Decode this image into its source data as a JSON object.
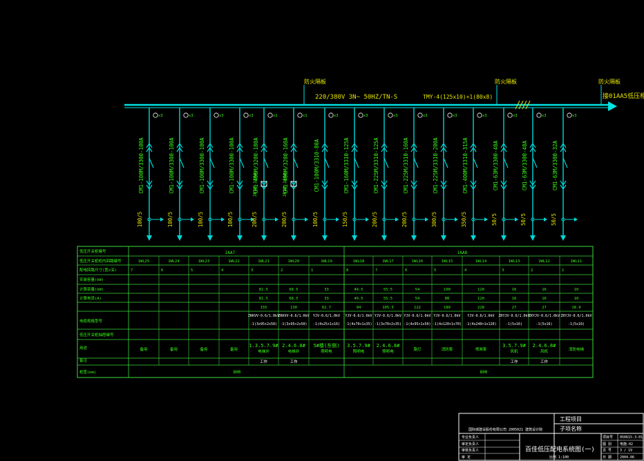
{
  "colors": {
    "background": "#000000",
    "bus": "#00e5e5",
    "feeder": "#00d8d8",
    "label_green": "#39ff14",
    "label_yellow": "#e6e600",
    "table_line": "#3cdc3c",
    "title_block": "#ffffff"
  },
  "top": {
    "marker1": "防火隔板",
    "marker2": "防火隔板",
    "marker3": "防火隔板",
    "bus_spec": "220/380V  3N~ 50HZ/TN-S",
    "busbar_spec": "TMY-4(125x10)+1(80x8)",
    "continuation": "接01AA5低压柜"
  },
  "feeders": [
    {
      "tag": "⑩x3",
      "breaker": "CM1-100M/3300-100A",
      "ct": "100/5",
      "type": "normal"
    },
    {
      "tag": "⑩x3",
      "breaker": "CM1-100M/3300-100A",
      "ct": "100/5",
      "type": "normal"
    },
    {
      "tag": "⑩x3",
      "breaker": "CM1-100M/3300-100A",
      "ct": "100/5",
      "type": "normal"
    },
    {
      "tag": "⑩x3",
      "breaker": "CM1-100M/3300-100A",
      "ct": "100/5",
      "type": "normal"
    },
    {
      "tag": "⑩x1",
      "breaker": "CM1-400M/3200-180A",
      "ct": "200/5",
      "type": "contactor",
      "relay": "JR22-180A"
    },
    {
      "tag": "⑩x1",
      "breaker": "CM1-400M/3200-160A",
      "ct": "200/5",
      "type": "contactor",
      "relay": "JR22-160A"
    },
    {
      "tag": "⑩x3",
      "breaker": "CM1-100M/3310-80A",
      "ct": "100/5",
      "type": "normal"
    },
    {
      "tag": "⑩x3",
      "breaker": "CM1-160M/3310-125A",
      "ct": "150/5",
      "type": "normal"
    },
    {
      "tag": "⑩x3",
      "breaker": "CM1-225M/3310-125A",
      "ct": "200/5",
      "type": "normal"
    },
    {
      "tag": "⑩x3",
      "breaker": "CM1-225M/3310-160A",
      "ct": "200/5",
      "type": "normal"
    },
    {
      "tag": "⑩x3",
      "breaker": "CM1-225M/3310-200A",
      "ct": "300/5",
      "type": "normal"
    },
    {
      "tag": "⑩x3",
      "breaker": "CM1-400M/3310-315A",
      "ct": "350/5",
      "type": "normal"
    },
    {
      "tag": "⑩x3",
      "breaker": "CM1-63M/3300-40A",
      "ct": "50/5",
      "type": "normal"
    },
    {
      "tag": "⑩x3",
      "breaker": "CM1-63M/3300-40A",
      "ct": "50/5",
      "type": "normal"
    },
    {
      "tag": "⑩x3",
      "breaker": "CM1-63M/3300-32A",
      "ct": "50/5",
      "type": "normal"
    }
  ],
  "table": {
    "row_labels": [
      "低压开关柜编号",
      "低压开关柜柜内回路编号",
      "配电回路尺寸(宽x深)",
      "安装容量(kW)",
      "计算容量(kW)",
      "计算电流(A)",
      "电缆规格型号",
      "低压开关柜抽屉编号",
      "用途",
      "备注",
      "柜宽(mm)"
    ],
    "cabinet_a": "1AA7",
    "cabinet_b": "1AA8",
    "circuit_nos": [
      "1WL25",
      "1WL24",
      "1WL23",
      "1WL22",
      "1WL21",
      "1WL20",
      "1WL19",
      "1WL18",
      "1WL17",
      "1WL16",
      "1WL15",
      "1WL14",
      "1WL13",
      "1WL12",
      "1WL11"
    ],
    "drawer_sizes": [
      "7",
      "6",
      "5",
      "4",
      "3",
      "2",
      "1",
      "8",
      "7",
      "6",
      "5",
      "4",
      "3",
      "2",
      "1"
    ],
    "installed_kw": [
      "",
      "",
      "",
      "",
      "81.5",
      "68.5",
      "33",
      "49.5",
      "55.5",
      "54",
      "100",
      "120",
      "16",
      "16",
      "10"
    ],
    "calc_kw": [
      "",
      "",
      "",
      "",
      "81.5",
      "68.5",
      "33",
      "49.5",
      "55.5",
      "54",
      "80",
      "120",
      "16",
      "16",
      "10"
    ],
    "calc_a": [
      "",
      "",
      "",
      "",
      "155",
      "130",
      "62.7",
      "94",
      "105.5",
      "122",
      "189",
      "228",
      "27",
      "27",
      "18.9"
    ],
    "cable_a": [
      "",
      "",
      "",
      "",
      "ZRKVV-0.6/1.0kV",
      "ZRKVV-0.6/1.0kV",
      "YJV-0.6/1.0kV",
      "YJV-0.6/1.0kV",
      "YJV-0.6/1.0kV",
      "YJV-0.6/1.0kV",
      "YJV-0.6/1.0kV",
      "YJV-0.6/1.0kV",
      "ZRYJV-0.6/1.0kV",
      "ZRYJV-0.6/1.0kV",
      "ZRYJV-0.6/1.0kV"
    ],
    "cable_b": [
      "",
      "",
      "",
      "",
      "-1(3x95+2x50)",
      "-1(3x95+2x50)",
      "-1(4x25+1x16)",
      "-1(4x70+1x35)",
      "-1(3x70+2x35)",
      "-1(4x95+1x50)",
      "-1(4x120+1x70)",
      "-1(4x240+1x120)",
      "-1(5x16)",
      "-1(5x16)",
      "-1(5x10)"
    ],
    "usage": [
      "备用",
      "备用",
      "备用",
      "备用",
      "1.3.5.7.9#\n电梯井",
      "2.4.6.8#\n电梯井",
      "5#楼(东侧)\n照明电",
      "3.5.7.9#\n照明电",
      "2.4.6.8#\n照明电",
      "路灯",
      "消防泵",
      "喷淋泵",
      "3.5.7.9#\n风机",
      "2.4.6.8#\n风机",
      "消防电梯"
    ],
    "remarks": [
      "",
      "",
      "",
      "",
      "工作",
      "工作",
      "",
      "",
      "",
      "",
      "",
      "",
      "工作",
      "工作",
      ""
    ],
    "width_a": "800",
    "width_b": "800"
  },
  "title_block": {
    "project_label": "工程项目",
    "sub_label": "子项名称",
    "company": "国际城建设股份有限公司 2005021 建筑设计院",
    "roles": [
      "专业负责人",
      "审定负责人",
      "审核负责人",
      "审  定"
    ],
    "drawing_title": "百佳低压配电系统图(一)",
    "meta_labels": [
      "项目号",
      "图 别",
      "页 号",
      "日 期"
    ],
    "meta_values": [
      "050615-3-01",
      "电施-02",
      "3 / 19",
      "2004.06"
    ],
    "scale": "比例 1:100"
  }
}
